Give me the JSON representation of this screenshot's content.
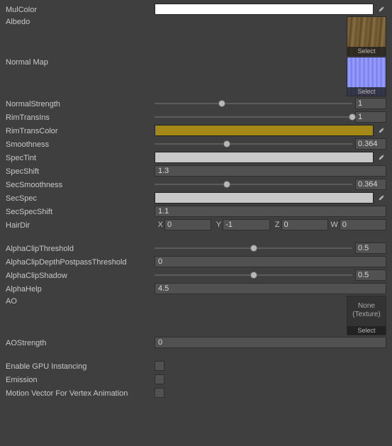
{
  "labels": {
    "mulColor": "MulColor",
    "albedo": "Albedo",
    "normalMap": "Normal Map",
    "normalStrength": "NormalStrength",
    "rimTransIns": "RimTransIns",
    "rimTransColor": "RimTransColor",
    "smoothness": "Smoothness",
    "specTint": "SpecTint",
    "specShift": "SpecShift",
    "secSmoothness": "SecSmoothness",
    "secSpec": "SecSpec",
    "secSpecShift": "SecSpecShift",
    "hairDir": "HairDir",
    "alphaClipThreshold": "AlphaClipThreshold",
    "alphaClipDepth": "AlphaClipDepthPostpassThreshold",
    "alphaClipShadow": "AlphaClipShadow",
    "alphaHelp": "AlphaHelp",
    "ao": "AO",
    "aoStrength": "AOStrength",
    "gpuInstancing": "Enable GPU Instancing",
    "emission": "Emission",
    "motionVector": "Motion Vector For Vertex Animation"
  },
  "texSlot": {
    "select": "Select",
    "none1": "None",
    "none2": "(Texture)"
  },
  "vecAxes": {
    "x": "X",
    "y": "Y",
    "z": "Z",
    "w": "W"
  },
  "values": {
    "mulColor": "#ffffff",
    "normalStrength": {
      "pct": 34,
      "val": "1"
    },
    "rimTransIns": {
      "pct": 100,
      "val": "1"
    },
    "rimTransColor": "#a48916",
    "smoothness": {
      "pct": 36.4,
      "val": "0.364"
    },
    "specTint": "#c8c8c8",
    "specShift": "1.3",
    "secSmoothness": {
      "pct": 36.4,
      "val": "0.364"
    },
    "secSpec": "#c8c8c8",
    "secSpecShift": "1.1",
    "hairDir": {
      "x": "0",
      "y": "-1",
      "z": "0",
      "w": "0"
    },
    "alphaClipThreshold": {
      "pct": 50,
      "val": "0.5"
    },
    "alphaClipDepth": "0",
    "alphaClipShadow": {
      "pct": 50,
      "val": "0.5"
    },
    "alphaHelp": "4.5",
    "aoStrength": "0",
    "gpuInstancing": false,
    "emission": false,
    "motionVector": false
  }
}
